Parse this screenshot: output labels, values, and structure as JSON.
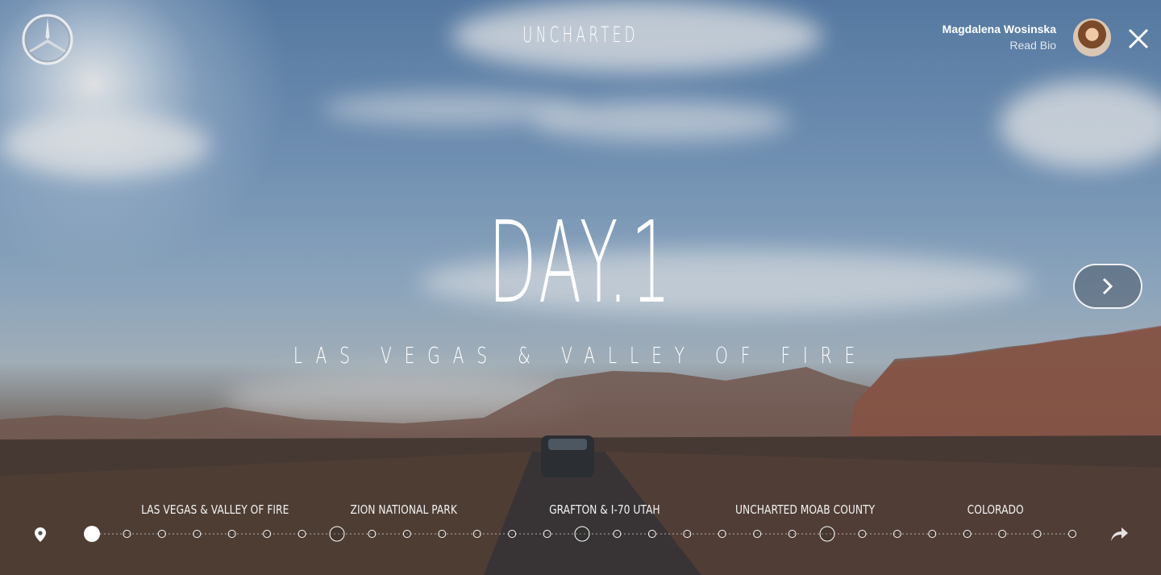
{
  "header": {
    "title": "UNCHARTED",
    "author_name": "Magdalena Wosinska",
    "author_link": "Read Bio"
  },
  "hero": {
    "title": "DAY.1",
    "subtitle": "LAS VEGAS & VALLEY OF FIRE"
  },
  "timeline": {
    "chapters": [
      "LAS VEGAS & VALLEY OF FIRE",
      "ZION NATIONAL PARK",
      "GRAFTON & I-70 UTAH",
      "UNCHARTED MOAB COUNTY",
      "COLORADO"
    ],
    "current_day": 1,
    "total_stops": 29
  },
  "icons": {
    "logo": "mercedes-star-icon",
    "close": "close-icon",
    "next": "chevron-right-icon",
    "location": "map-pin-icon",
    "share": "share-arrow-icon"
  }
}
